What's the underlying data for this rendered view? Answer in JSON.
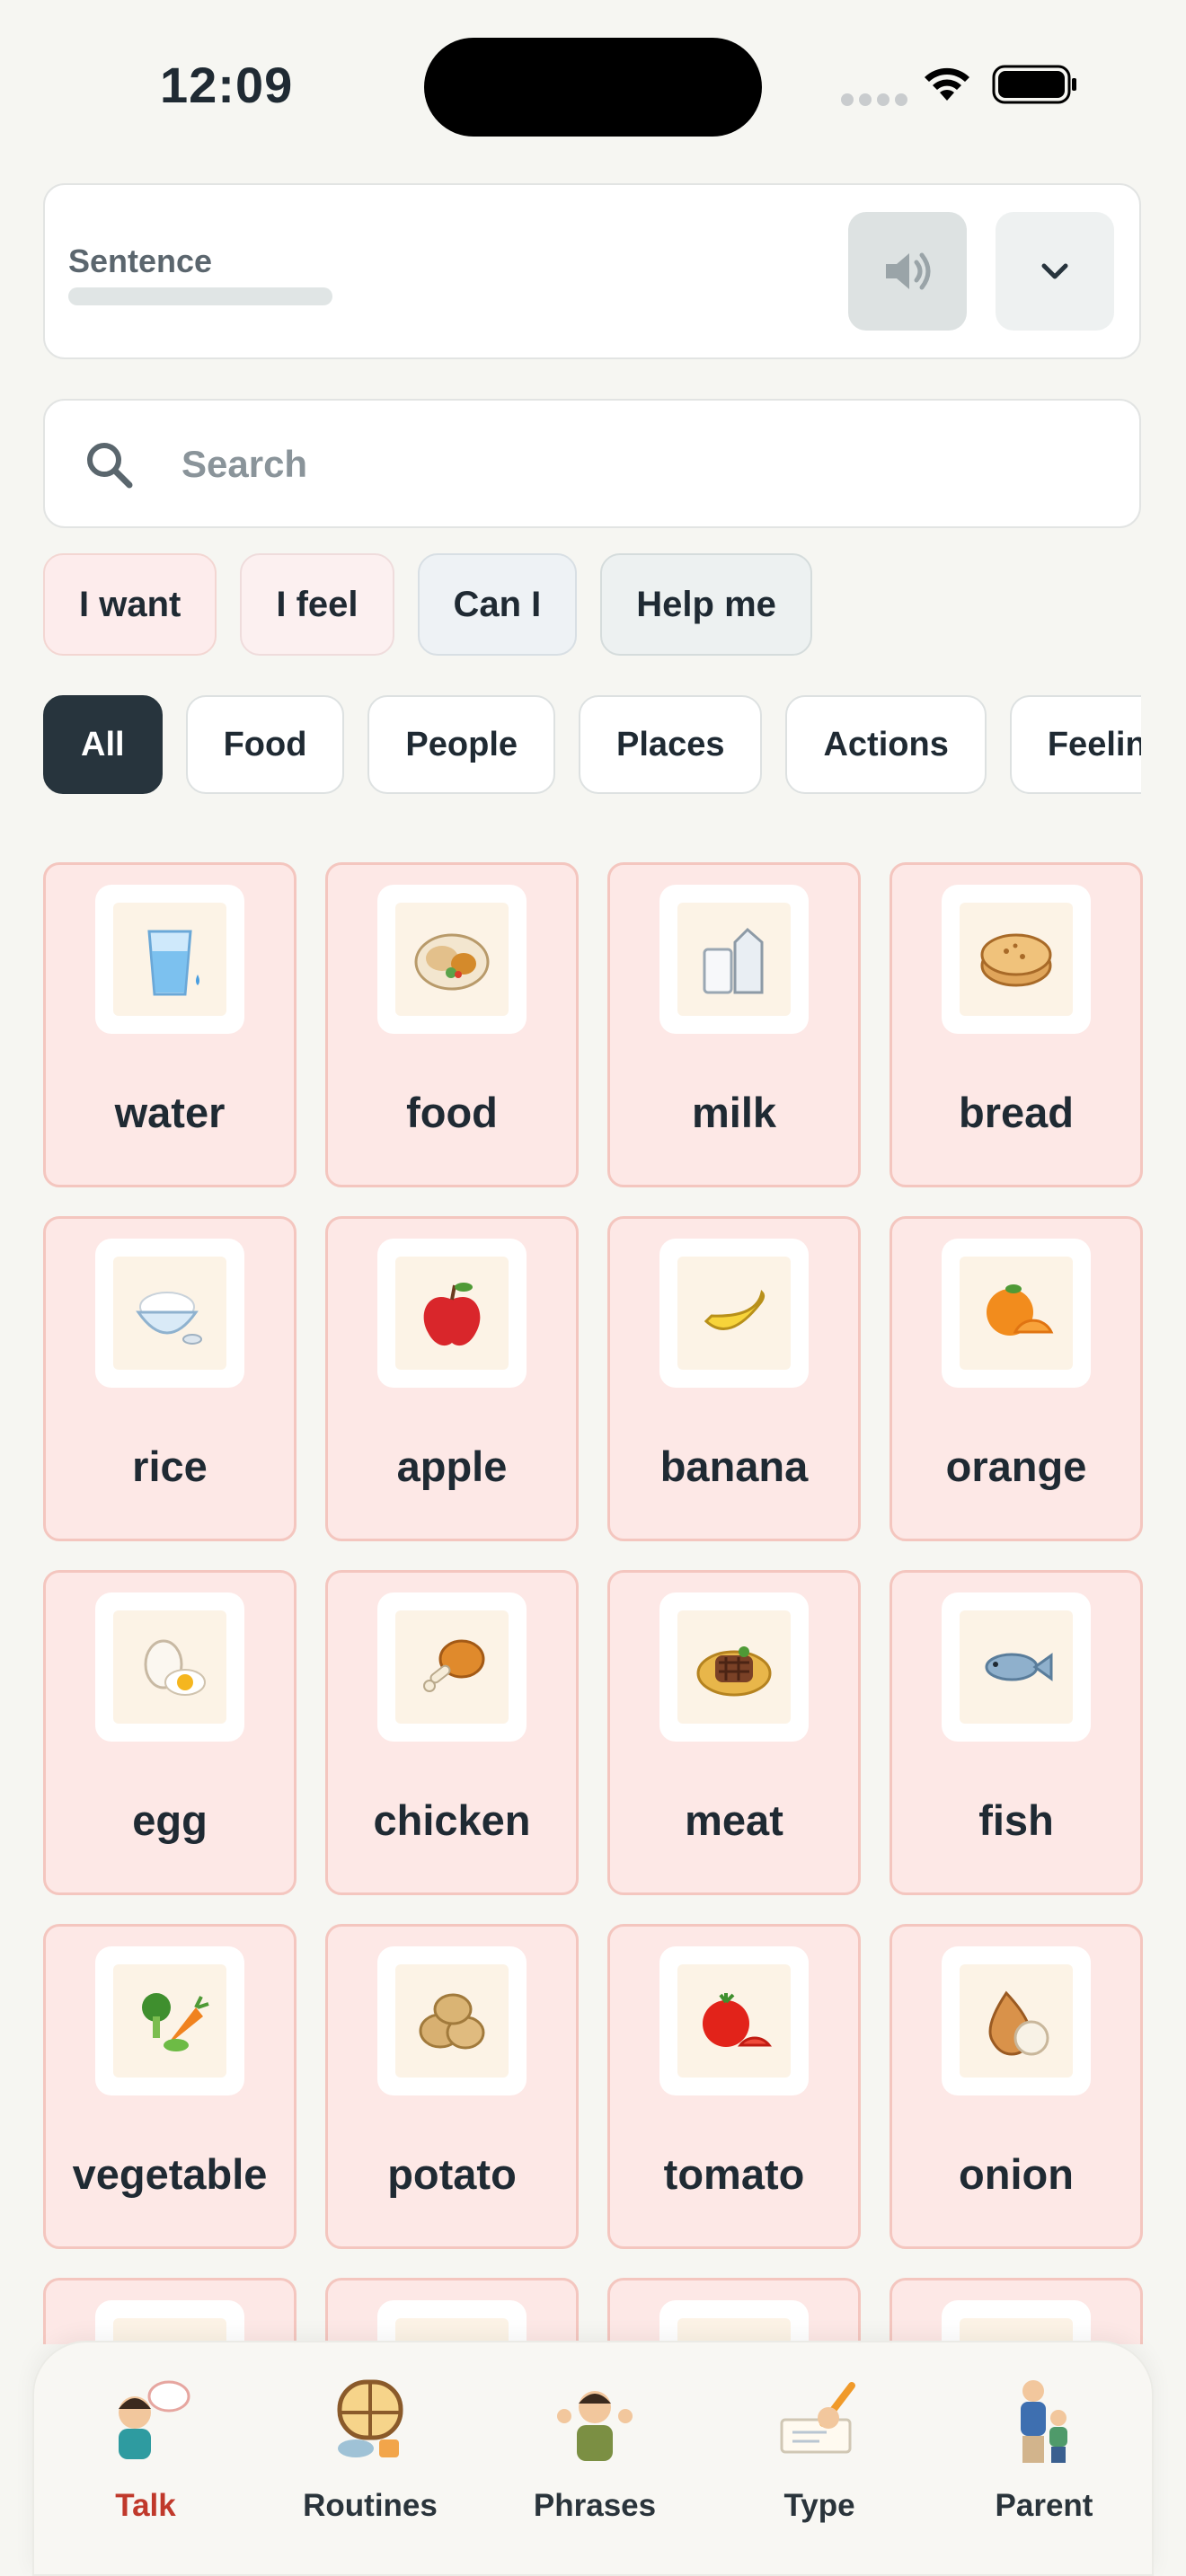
{
  "status_bar": {
    "time": "12:09"
  },
  "sentence": {
    "label": "Sentence"
  },
  "search": {
    "placeholder": "Search"
  },
  "quick_phrases": [
    {
      "label": "I want",
      "bg": "#fdecec",
      "border": "#f3d6d2"
    },
    {
      "label": "I feel",
      "bg": "#fcf0f0",
      "border": "#efdcdc"
    },
    {
      "label": "Can I",
      "bg": "#eef2f5",
      "border": "#d8dfe4"
    },
    {
      "label": "Help me",
      "bg": "#edf1f1",
      "border": "#d5dcdc"
    }
  ],
  "categories": [
    {
      "label": "All",
      "active": true
    },
    {
      "label": "Food",
      "active": false
    },
    {
      "label": "People",
      "active": false
    },
    {
      "label": "Places",
      "active": false
    },
    {
      "label": "Actions",
      "active": false
    },
    {
      "label": "Feelings",
      "active": false
    }
  ],
  "words": [
    {
      "label": "water",
      "icon": "water-glass-icon"
    },
    {
      "label": "food",
      "icon": "food-plate-icon"
    },
    {
      "label": "milk",
      "icon": "milk-icon"
    },
    {
      "label": "bread",
      "icon": "bread-icon"
    },
    {
      "label": "rice",
      "icon": "rice-bowl-icon"
    },
    {
      "label": "apple",
      "icon": "apple-icon"
    },
    {
      "label": "banana",
      "icon": "banana-icon"
    },
    {
      "label": "orange",
      "icon": "orange-icon"
    },
    {
      "label": "egg",
      "icon": "egg-icon"
    },
    {
      "label": "chicken",
      "icon": "chicken-leg-icon"
    },
    {
      "label": "meat",
      "icon": "meat-icon"
    },
    {
      "label": "fish",
      "icon": "fish-icon"
    },
    {
      "label": "vegetable",
      "icon": "vegetable-icon"
    },
    {
      "label": "potato",
      "icon": "potato-icon"
    },
    {
      "label": "tomato",
      "icon": "tomato-icon"
    },
    {
      "label": "onion",
      "icon": "onion-icon"
    }
  ],
  "nav": [
    {
      "label": "Talk",
      "icon": "talking-child-icon",
      "active": true
    },
    {
      "label": "Routines",
      "icon": "routine-window-icon",
      "active": false
    },
    {
      "label": "Phrases",
      "icon": "waving-child-icon",
      "active": false
    },
    {
      "label": "Type",
      "icon": "writing-hand-icon",
      "active": false
    },
    {
      "label": "Parent",
      "icon": "parent-child-icon",
      "active": false
    }
  ],
  "colors": {
    "accent_active_nav": "#c0392b",
    "tile_bg": "#fde8e6",
    "tile_border": "#f4c6bf",
    "active_tab": "#27343d"
  }
}
